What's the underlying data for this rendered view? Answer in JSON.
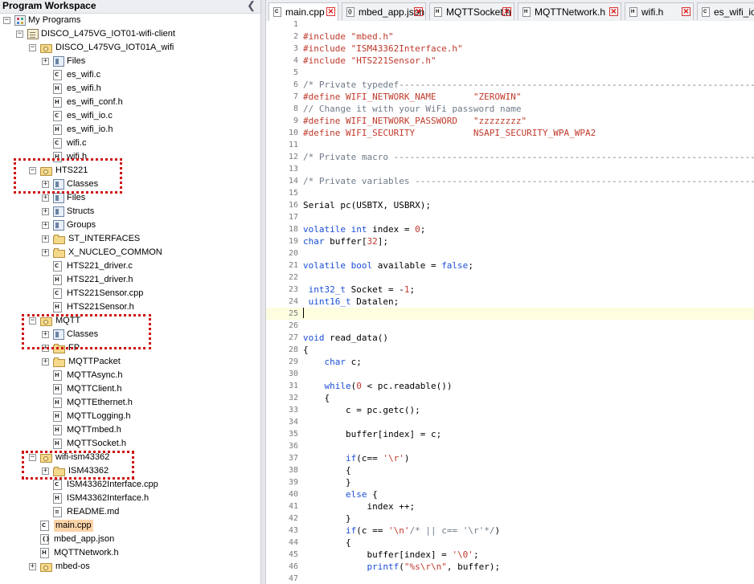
{
  "workspace": {
    "title": "Program Workspace",
    "collapse_icon": "chevron-left-icon"
  },
  "tree": [
    {
      "label": "My Programs",
      "depth": 0,
      "exp": "-",
      "icon": "programs"
    },
    {
      "label": "DISCO_L475VG_IOT01-wifi-client",
      "depth": 1,
      "exp": "-",
      "icon": "program"
    },
    {
      "label": "DISCO_L475VG_IOT01A_wifi",
      "depth": 2,
      "exp": "-",
      "icon": "lib"
    },
    {
      "label": "Files",
      "depth": 3,
      "exp": "+",
      "icon": "group"
    },
    {
      "label": "es_wifi.c",
      "depth": 3,
      "icon": "file",
      "ft": "c"
    },
    {
      "label": "es_wifi.h",
      "depth": 3,
      "icon": "file",
      "ft": "h"
    },
    {
      "label": "es_wifi_conf.h",
      "depth": 3,
      "icon": "file",
      "ft": "h"
    },
    {
      "label": "es_wifi_io.c",
      "depth": 3,
      "icon": "file",
      "ft": "c"
    },
    {
      "label": "es_wifi_io.h",
      "depth": 3,
      "icon": "file",
      "ft": "h"
    },
    {
      "label": "wifi.c",
      "depth": 3,
      "icon": "file",
      "ft": "c"
    },
    {
      "label": "wifi.h",
      "depth": 3,
      "icon": "file",
      "ft": "h"
    },
    {
      "label": "HTS221",
      "depth": 2,
      "exp": "-",
      "icon": "lib"
    },
    {
      "label": "Classes",
      "depth": 3,
      "exp": "+",
      "icon": "group"
    },
    {
      "label": "Files",
      "depth": 3,
      "exp": "+",
      "icon": "group"
    },
    {
      "label": "Structs",
      "depth": 3,
      "exp": "+",
      "icon": "group"
    },
    {
      "label": "Groups",
      "depth": 3,
      "exp": "+",
      "icon": "group"
    },
    {
      "label": "ST_INTERFACES",
      "depth": 3,
      "exp": "+",
      "icon": "folder"
    },
    {
      "label": "X_NUCLEO_COMMON",
      "depth": 3,
      "exp": "+",
      "icon": "folder"
    },
    {
      "label": "HTS221_driver.c",
      "depth": 3,
      "icon": "file",
      "ft": "c"
    },
    {
      "label": "HTS221_driver.h",
      "depth": 3,
      "icon": "file",
      "ft": "h"
    },
    {
      "label": "HTS221Sensor.cpp",
      "depth": 3,
      "icon": "file",
      "ft": "c"
    },
    {
      "label": "HTS221Sensor.h",
      "depth": 3,
      "icon": "file",
      "ft": "h"
    },
    {
      "label": "MQTT",
      "depth": 2,
      "exp": "-",
      "icon": "lib"
    },
    {
      "label": "Classes",
      "depth": 3,
      "exp": "+",
      "icon": "group"
    },
    {
      "label": "FP",
      "depth": 3,
      "exp": "+",
      "icon": "folder"
    },
    {
      "label": "MQTTPacket",
      "depth": 3,
      "exp": "+",
      "icon": "folder"
    },
    {
      "label": "MQTTAsync.h",
      "depth": 3,
      "icon": "file",
      "ft": "h"
    },
    {
      "label": "MQTTClient.h",
      "depth": 3,
      "icon": "file",
      "ft": "h"
    },
    {
      "label": "MQTTEthernet.h",
      "depth": 3,
      "icon": "file",
      "ft": "h"
    },
    {
      "label": "MQTTLogging.h",
      "depth": 3,
      "icon": "file",
      "ft": "h"
    },
    {
      "label": "MQTTmbed.h",
      "depth": 3,
      "icon": "file",
      "ft": "h"
    },
    {
      "label": "MQTTSocket.h",
      "depth": 3,
      "icon": "file",
      "ft": "h"
    },
    {
      "label": "wifi-ism43362",
      "depth": 2,
      "exp": "-",
      "icon": "lib"
    },
    {
      "label": "ISM43362",
      "depth": 3,
      "exp": "+",
      "icon": "folder"
    },
    {
      "label": "ISM43362Interface.cpp",
      "depth": 3,
      "icon": "file",
      "ft": "c"
    },
    {
      "label": "ISM43362Interface.h",
      "depth": 3,
      "icon": "file",
      "ft": "h"
    },
    {
      "label": "README.md",
      "depth": 3,
      "icon": "file",
      "ft": "t"
    },
    {
      "label": "main.cpp",
      "depth": 2,
      "icon": "file",
      "ft": "c",
      "selected": true
    },
    {
      "label": "mbed_app.json",
      "depth": 2,
      "icon": "file",
      "ft": "j"
    },
    {
      "label": "MQTTNetwork.h",
      "depth": 2,
      "icon": "file",
      "ft": "h"
    },
    {
      "label": "mbed-os",
      "depth": 2,
      "exp": "+",
      "icon": "lib"
    }
  ],
  "tabs": [
    {
      "label": "main.cpp",
      "ft": "c",
      "active": true
    },
    {
      "label": "mbed_app.json",
      "ft": "j"
    },
    {
      "label": "MQTTSocket.h",
      "ft": "h"
    },
    {
      "label": "MQTTNetwork.h",
      "ft": "h"
    },
    {
      "label": "wifi.h",
      "ft": "h"
    },
    {
      "label": "es_wifi_io.c",
      "ft": "c"
    }
  ],
  "code": [
    {
      "n": "1",
      "t": []
    },
    {
      "n": "2",
      "t": [
        [
          "pre",
          "#include \"mbed.h\""
        ]
      ]
    },
    {
      "n": "3",
      "t": [
        [
          "pre",
          "#include \"ISM43362Interface.h\""
        ]
      ]
    },
    {
      "n": "4",
      "t": [
        [
          "pre",
          "#include \"HTS221Sensor.h\""
        ]
      ]
    },
    {
      "n": "5",
      "t": []
    },
    {
      "n": "6",
      "t": [
        [
          "com",
          "/* Private typedef-----------------------------------------------------------------------"
        ]
      ]
    },
    {
      "n": "7",
      "t": [
        [
          "pre",
          "#define WIFI_NETWORK_NAME       \"ZEROWIN\""
        ]
      ]
    },
    {
      "n": "8",
      "t": [
        [
          "com",
          "// Change it with your WiFi password name"
        ]
      ]
    },
    {
      "n": "9",
      "t": [
        [
          "pre",
          "#define WIFI_NETWORK_PASSWORD   \"zzzzzzzz\""
        ]
      ]
    },
    {
      "n": "10",
      "t": [
        [
          "pre",
          "#define WIFI_SECURITY           NSAPI_SECURITY_WPA_WPA2"
        ]
      ]
    },
    {
      "n": "11",
      "t": []
    },
    {
      "n": "12",
      "t": [
        [
          "com",
          "/* Private macro -------------------------------------------------------------------------"
        ]
      ]
    },
    {
      "n": "13",
      "t": []
    },
    {
      "n": "14",
      "t": [
        [
          "com",
          "/* Private variables ---------------------------------------------------------------------"
        ]
      ]
    },
    {
      "n": "15",
      "t": []
    },
    {
      "n": "16",
      "t": [
        [
          "pl",
          "Serial pc(USBTX, USBRX);"
        ]
      ]
    },
    {
      "n": "17",
      "t": []
    },
    {
      "n": "18",
      "t": [
        [
          "kw",
          "volatile int"
        ],
        [
          "pl",
          " index = "
        ],
        [
          "num",
          "0"
        ],
        [
          "pl",
          ";"
        ]
      ]
    },
    {
      "n": "19",
      "t": [
        [
          "kw",
          "char"
        ],
        [
          "pl",
          " buffer["
        ],
        [
          "num",
          "32"
        ],
        [
          "pl",
          "];"
        ]
      ]
    },
    {
      "n": "20",
      "t": []
    },
    {
      "n": "21",
      "t": [
        [
          "kw",
          "volatile bool"
        ],
        [
          "pl",
          " available = "
        ],
        [
          "kw",
          "false"
        ],
        [
          "pl",
          ";"
        ]
      ]
    },
    {
      "n": "22",
      "t": []
    },
    {
      "n": "23",
      "t": [
        [
          "pl",
          " "
        ],
        [
          "kw",
          "int32_t"
        ],
        [
          "pl",
          " Socket = -"
        ],
        [
          "num",
          "1"
        ],
        [
          "pl",
          ";"
        ]
      ]
    },
    {
      "n": "24",
      "t": [
        [
          "pl",
          " "
        ],
        [
          "kw",
          "uint16_t"
        ],
        [
          "pl",
          " Datalen;"
        ]
      ]
    },
    {
      "n": "25",
      "t": [],
      "cur": true
    },
    {
      "n": "26",
      "t": []
    },
    {
      "n": "27",
      "t": [
        [
          "kw",
          "void"
        ],
        [
          "pl",
          " read_data()"
        ]
      ]
    },
    {
      "n": "28",
      "t": [
        [
          "pl",
          "{"
        ]
      ]
    },
    {
      "n": "29",
      "t": [
        [
          "pl",
          "    "
        ],
        [
          "kw",
          "char"
        ],
        [
          "pl",
          " c;"
        ]
      ]
    },
    {
      "n": "30",
      "t": []
    },
    {
      "n": "31",
      "t": [
        [
          "pl",
          "    "
        ],
        [
          "kw",
          "while"
        ],
        [
          "pl",
          "("
        ],
        [
          "num",
          "0"
        ],
        [
          "pl",
          " < pc.readable())"
        ]
      ]
    },
    {
      "n": "32",
      "t": [
        [
          "pl",
          "    {"
        ]
      ]
    },
    {
      "n": "33",
      "t": [
        [
          "pl",
          "        c = pc.getc();"
        ]
      ]
    },
    {
      "n": "34",
      "t": []
    },
    {
      "n": "35",
      "t": [
        [
          "pl",
          "        buffer[index] = c;"
        ]
      ]
    },
    {
      "n": "36",
      "t": []
    },
    {
      "n": "37",
      "t": [
        [
          "pl",
          "        "
        ],
        [
          "kw",
          "if"
        ],
        [
          "pl",
          "(c== "
        ],
        [
          "str",
          "'\\r'"
        ],
        [
          "pl",
          ")"
        ]
      ]
    },
    {
      "n": "38",
      "t": [
        [
          "pl",
          "        {"
        ]
      ]
    },
    {
      "n": "39",
      "t": [
        [
          "pl",
          "        }"
        ]
      ]
    },
    {
      "n": "40",
      "t": [
        [
          "pl",
          "        "
        ],
        [
          "kw",
          "else"
        ],
        [
          "pl",
          " {"
        ]
      ]
    },
    {
      "n": "41",
      "t": [
        [
          "pl",
          "            index ++;"
        ]
      ]
    },
    {
      "n": "42",
      "t": [
        [
          "pl",
          "        }"
        ]
      ]
    },
    {
      "n": "43",
      "t": [
        [
          "pl",
          "        "
        ],
        [
          "kw",
          "if"
        ],
        [
          "pl",
          "(c == "
        ],
        [
          "str",
          "'\\n'"
        ],
        [
          "com",
          "/* || c== '\\r'*/"
        ],
        [
          "pl",
          ")"
        ]
      ]
    },
    {
      "n": "44",
      "t": [
        [
          "pl",
          "        {"
        ]
      ]
    },
    {
      "n": "45",
      "t": [
        [
          "pl",
          "            buffer[index] = "
        ],
        [
          "str",
          "'\\0'"
        ],
        [
          "pl",
          ";"
        ]
      ]
    },
    {
      "n": "46",
      "t": [
        [
          "pl",
          "            "
        ],
        [
          "kw",
          "printf"
        ],
        [
          "pl",
          "("
        ],
        [
          "str",
          "\"%s\\r\\n\""
        ],
        [
          "pl",
          ", buffer);"
        ]
      ]
    },
    {
      "n": "47",
      "t": []
    }
  ]
}
